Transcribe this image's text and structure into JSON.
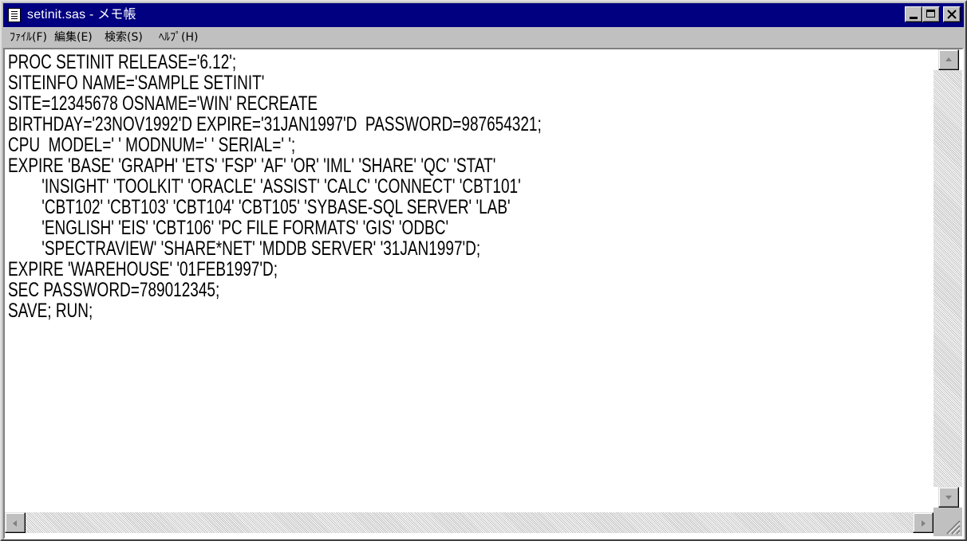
{
  "window": {
    "title": "setinit.sas - メモ帳",
    "icons": {
      "app": "notepad-icon",
      "minimize": "minimize-icon",
      "maximize": "maximize-icon",
      "close": "close-icon"
    }
  },
  "menubar": {
    "items": [
      {
        "label": "ﾌｧｲﾙ(F)"
      },
      {
        "label": "編集(E)"
      },
      {
        "label": "検索(S)"
      },
      {
        "label": "ﾍﾙﾌﾟ(H)"
      }
    ]
  },
  "editor": {
    "lines": [
      "PROC SETINIT RELEASE='6.12';",
      "SITEINFO NAME='SAMPLE SETINIT'",
      "SITE=12345678 OSNAME='WIN' RECREATE",
      "BIRTHDAY='23NOV1992'D EXPIRE='31JAN1997'D  PASSWORD=987654321;",
      "CPU  MODEL=' ' MODNUM=' ' SERIAL=' ';",
      "EXPIRE 'BASE' 'GRAPH' 'ETS' 'FSP' 'AF' 'OR' 'IML' 'SHARE' 'QC' 'STAT'",
      "        'INSIGHT' 'TOOLKIT' 'ORACLE' 'ASSIST' 'CALC' 'CONNECT' 'CBT101'",
      "        'CBT102' 'CBT103' 'CBT104' 'CBT105' 'SYBASE-SQL SERVER' 'LAB'",
      "        'ENGLISH' 'EIS' 'CBT106' 'PC FILE FORMATS' 'GIS' 'ODBC'",
      "        'SPECTRAVIEW' 'SHARE*NET' 'MDDB SERVER' '31JAN1997'D;",
      "EXPIRE 'WAREHOUSE' '01FEB1997'D;",
      "SEC PASSWORD=789012345;",
      "SAVE; RUN;"
    ]
  },
  "scrollbars": {
    "icons": {
      "up": "arrow-up-icon",
      "down": "arrow-down-icon",
      "left": "arrow-left-icon",
      "right": "arrow-right-icon",
      "grip": "size-grip-icon"
    }
  }
}
